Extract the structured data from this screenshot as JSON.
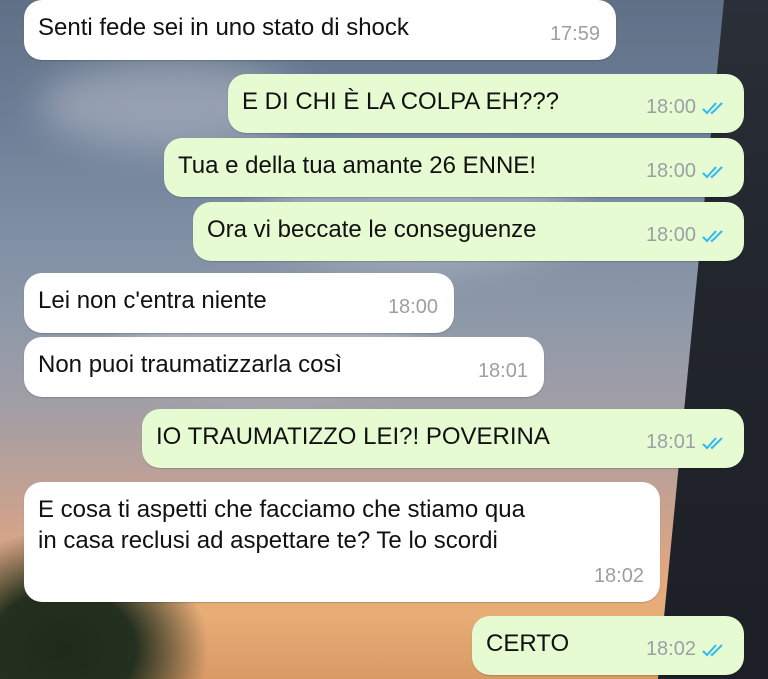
{
  "messages": [
    {
      "text": "Senti fede sei in uno stato di shock",
      "time": "17:59",
      "dir": "in"
    },
    {
      "text": "E DI CHI È LA COLPA EH???",
      "time": "18:00",
      "dir": "out"
    },
    {
      "text": "Tua e della tua amante 26 ENNE!",
      "time": "18:00",
      "dir": "out"
    },
    {
      "text": "Ora vi beccate le conseguenze",
      "time": "18:00",
      "dir": "out"
    },
    {
      "text": "Lei non c'entra niente",
      "time": "18:00",
      "dir": "in"
    },
    {
      "text": "Non puoi traumatizzarla così",
      "time": "18:01",
      "dir": "in"
    },
    {
      "text": "IO TRAUMATIZZO LEI?! POVERINA",
      "time": "18:01",
      "dir": "out"
    },
    {
      "text": "E cosa ti aspetti che facciamo che stiamo qua\nin casa reclusi ad aspettare te? Te lo scordi",
      "time": "18:02",
      "dir": "in"
    },
    {
      "text": "CERTO",
      "time": "18:02",
      "dir": "out"
    }
  ],
  "colors": {
    "incoming": "#ffffff",
    "outgoing": "#e7fbd3",
    "read_ticks": "#34b7f1"
  },
  "icons": {
    "read_receipt": "double-check-icon"
  }
}
